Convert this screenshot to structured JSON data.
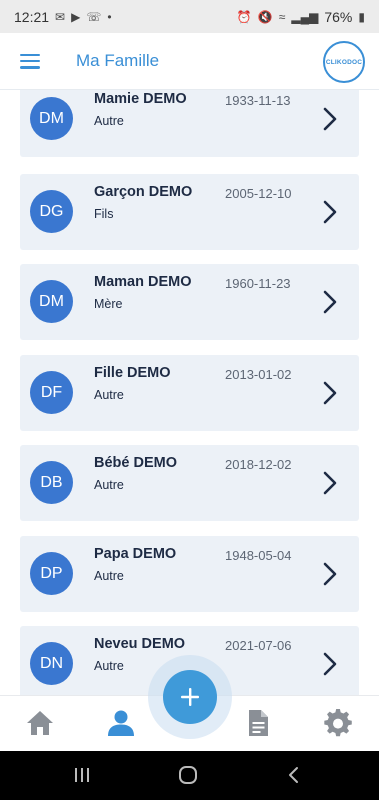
{
  "status_bar": {
    "time": "12:21",
    "battery": "76%"
  },
  "header": {
    "title": "Ma Famille",
    "logo_text": "CLIKODOC"
  },
  "members": [
    {
      "initials": "DM",
      "name": "Mamie DEMO",
      "relation": "Autre",
      "birthdate": "1933-11-13"
    },
    {
      "initials": "DG",
      "name": "Garçon DEMO",
      "relation": "Fils",
      "birthdate": "2005-12-10"
    },
    {
      "initials": "DM",
      "name": "Maman DEMO",
      "relation": "Mère",
      "birthdate": "1960-11-23"
    },
    {
      "initials": "DF",
      "name": "Fille DEMO",
      "relation": "Autre",
      "birthdate": "2013-01-02"
    },
    {
      "initials": "DB",
      "name": "Bébé DEMO",
      "relation": "Autre",
      "birthdate": "2018-12-02"
    },
    {
      "initials": "DP",
      "name": "Papa DEMO",
      "relation": "Autre",
      "birthdate": "1948-05-04"
    },
    {
      "initials": "DN",
      "name": "Neveu DEMO",
      "relation": "Autre",
      "birthdate": "2021-07-06"
    }
  ],
  "bottom_nav": {
    "items": [
      {
        "icon": "home-icon",
        "active": false
      },
      {
        "icon": "person-icon",
        "active": true
      },
      {
        "icon": "add-icon",
        "active": false
      },
      {
        "icon": "document-icon",
        "active": false
      },
      {
        "icon": "settings-icon",
        "active": false
      }
    ]
  },
  "colors": {
    "accent": "#3a8fd6",
    "avatar": "#3a77d0",
    "card": "#ecf1f7",
    "nav_active": "#3a8fd6",
    "nav_inactive": "#8a8f96"
  }
}
